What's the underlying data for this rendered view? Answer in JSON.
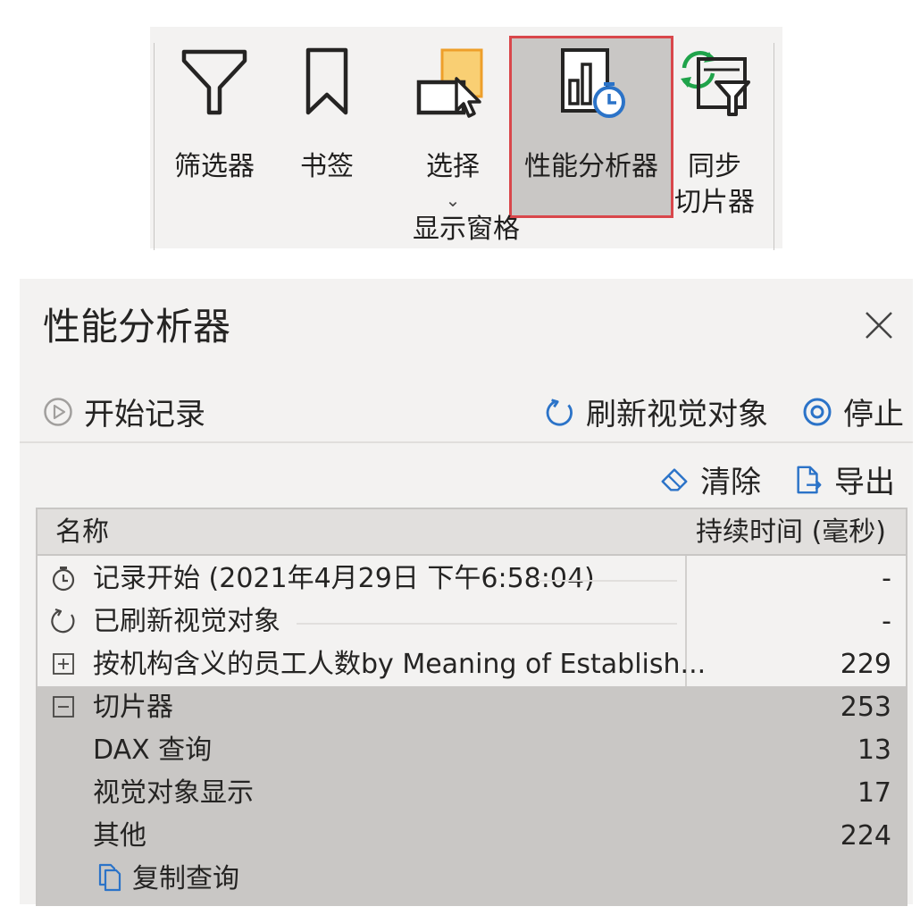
{
  "ribbon": {
    "buttons": [
      {
        "label": "筛选器",
        "icon": "filter-icon"
      },
      {
        "label": "书签",
        "icon": "bookmark-icon"
      },
      {
        "label": "选择",
        "icon": "selection-icon",
        "chevron": "⌄"
      },
      {
        "label": "性能分析器",
        "icon": "performance-analyzer-icon",
        "selected": true
      },
      {
        "label_line1": "同步",
        "label_line2": "切片器",
        "icon": "sync-slicers-icon"
      }
    ],
    "group_label": "显示窗格",
    "highlight_color": "#d9474b"
  },
  "pane": {
    "title": "性能分析器",
    "close_icon": "close-icon",
    "commands": {
      "start_recording": "开始记录",
      "refresh_visuals": "刷新视觉对象",
      "stop": "停止",
      "clear": "清除",
      "export": "导出"
    },
    "table": {
      "col_name": "名称",
      "col_duration": "持续时间 (毫秒)",
      "rows": [
        {
          "icon": "stopwatch-icon",
          "name": "记录开始 (2021年4月29日 下午6:58:04)",
          "value": "-"
        },
        {
          "icon": "refresh-icon",
          "name": "已刷新视觉对象",
          "value": "-"
        },
        {
          "icon": "expand-icon",
          "name": "按机构含义的员工人数by Meaning of Establish...",
          "value": "229"
        },
        {
          "icon": "collapse-icon",
          "name": "切片器",
          "value": "253"
        },
        {
          "name": "DAX 查询",
          "value": "13"
        },
        {
          "name": "视觉对象显示",
          "value": "17"
        },
        {
          "name": "其他",
          "value": "224"
        },
        {
          "icon": "copy-icon",
          "name": "复制查询"
        }
      ]
    },
    "accent_color": "#2b73c8"
  }
}
